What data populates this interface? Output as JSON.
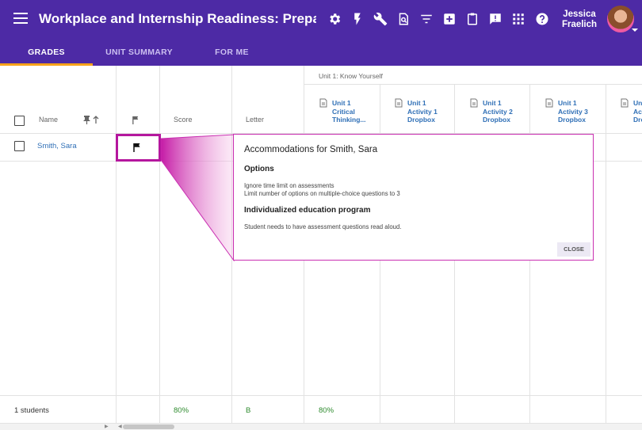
{
  "header": {
    "title": "Workplace and Internship Readiness: Preparing for ...",
    "user_first": "Jessica",
    "user_last": "Fraelich",
    "tools": [
      "gear-icon",
      "lightning-icon",
      "wrench-icon",
      "preview-icon",
      "filter-icon",
      "add-box-icon",
      "clipboard-icon",
      "feedback-icon",
      "apps-grid-icon",
      "help-icon"
    ]
  },
  "tabs": [
    {
      "label": "GRADES",
      "active": true
    },
    {
      "label": "UNIT SUMMARY",
      "active": false
    },
    {
      "label": "FOR ME",
      "active": false
    }
  ],
  "grid": {
    "unit_group": "Unit 1: Know Yourself",
    "columns": {
      "name": "Name",
      "score": "Score",
      "letter": "Letter"
    },
    "assignments": [
      {
        "line1": "Unit 1",
        "line2": "Critical",
        "line3": "Thinking..."
      },
      {
        "line1": "Unit 1",
        "line2": "Activity 1",
        "line3": "Dropbox"
      },
      {
        "line1": "Unit 1",
        "line2": "Activity 2",
        "line3": "Dropbox"
      },
      {
        "line1": "Unit 1",
        "line2": "Activity 3",
        "line3": "Dropbox"
      },
      {
        "line1": "Un",
        "line2": "Ac",
        "line3": "Dro"
      }
    ],
    "rows": [
      {
        "name": "Smith, Sara"
      }
    ]
  },
  "popup": {
    "title": "Accommodations for Smith, Sara",
    "section1": "Options",
    "option1": "Ignore time limit on assessments",
    "option2": "Limit number of options on multiple-choice questions to 3",
    "section2": "Individualized education program",
    "iep_text": "Student needs to have assessment questions read aloud.",
    "close_label": "CLOSE"
  },
  "footer": {
    "count": "1 students",
    "score": "80%",
    "letter": "B",
    "assignment1": "80%"
  },
  "colors": {
    "header": "#4d2aa5",
    "accent": "#f7a21a",
    "highlight": "#b5179e",
    "link": "#2f6fb6",
    "positive": "#2e8b2e"
  }
}
